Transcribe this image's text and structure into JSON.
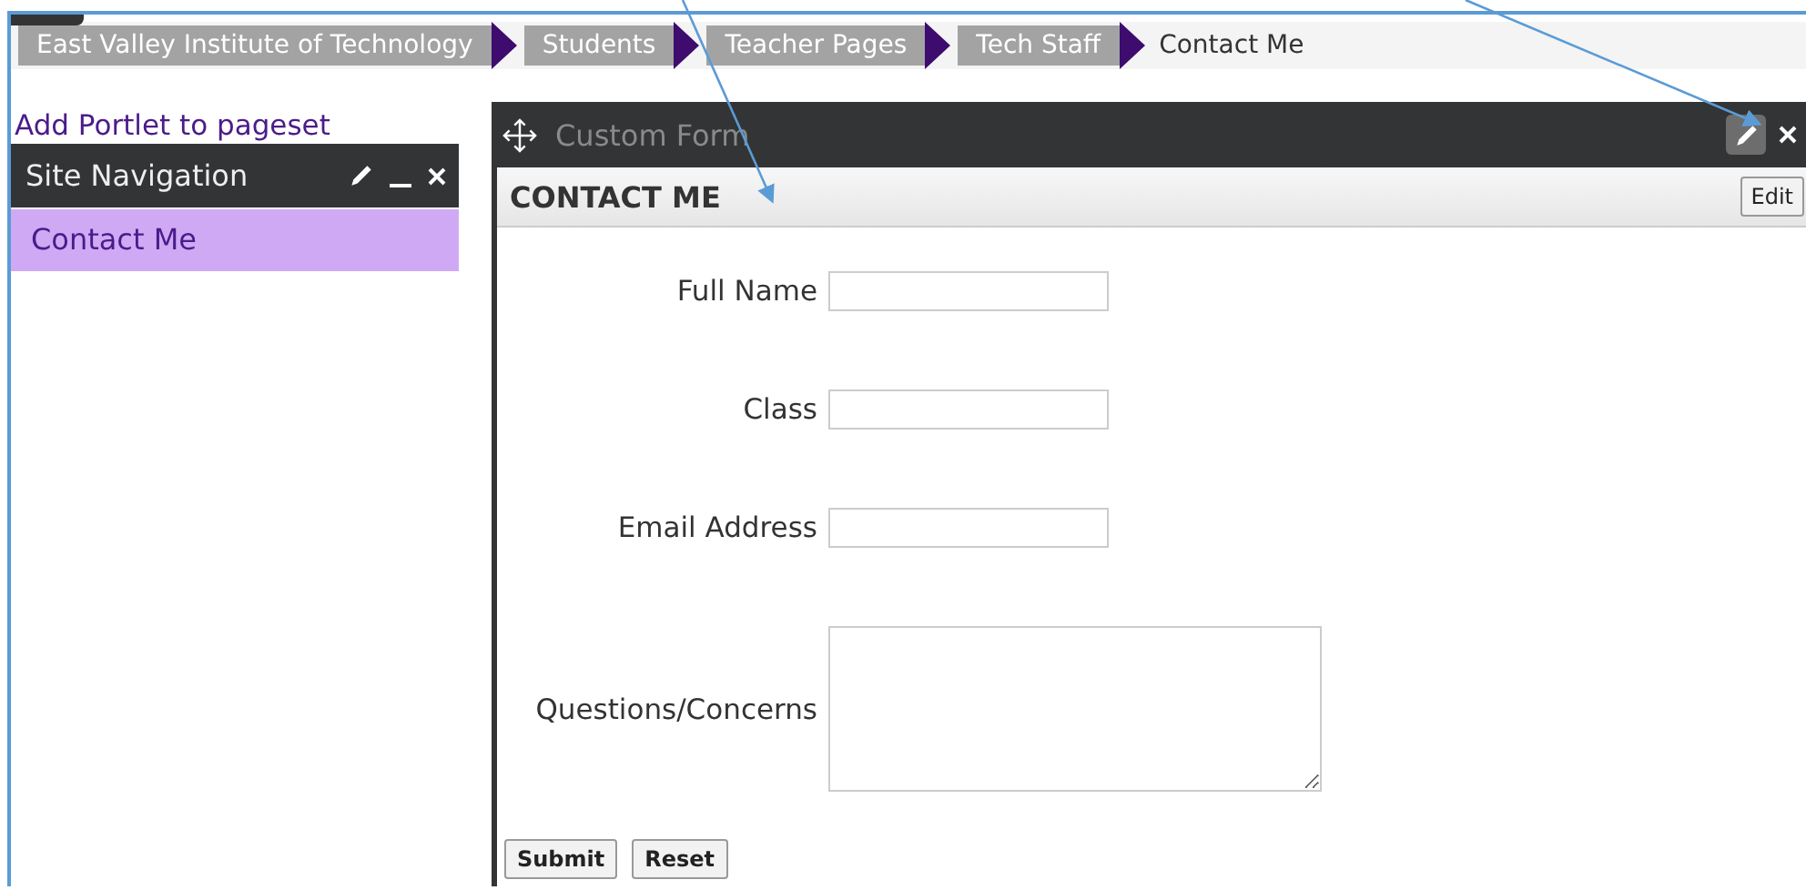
{
  "breadcrumbs": [
    {
      "label": "East Valley Institute of Technology",
      "current": false
    },
    {
      "label": "Students",
      "current": false
    },
    {
      "label": "Teacher Pages",
      "current": false
    },
    {
      "label": "Tech Staff",
      "current": false
    },
    {
      "label": "Contact Me",
      "current": true
    }
  ],
  "add_portlet_link": "Add Portlet to pageset",
  "site_navigation": {
    "title": "Site Navigation",
    "items": [
      {
        "label": "Contact Me",
        "selected": true
      }
    ]
  },
  "custom_form": {
    "title": "Custom Form",
    "heading": "CONTACT ME",
    "edit_button": "Edit",
    "fields": [
      {
        "label": "Full Name",
        "kind": "text"
      },
      {
        "label": "Class",
        "kind": "text"
      },
      {
        "label": "Email Address",
        "kind": "text"
      },
      {
        "label": "Questions/Concerns",
        "kind": "textarea"
      }
    ],
    "buttons": [
      "Submit",
      "Reset"
    ]
  }
}
